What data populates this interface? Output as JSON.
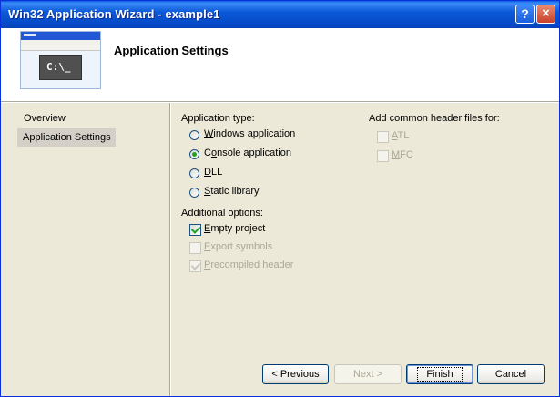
{
  "window": {
    "title": "Win32 Application Wizard - example1"
  },
  "titlebar_buttons": {
    "help": "?",
    "close": "×"
  },
  "header": {
    "title": "Application Settings",
    "console_text": "C:\\_"
  },
  "nav": {
    "items": [
      "Overview",
      "Application Settings"
    ],
    "selected_index": 1
  },
  "app_type": {
    "label": "Application type:",
    "options": [
      {
        "pre": "",
        "key": "W",
        "post": "indows application",
        "checked": false
      },
      {
        "pre": "C",
        "key": "o",
        "post": "nsole application",
        "checked": true
      },
      {
        "pre": "",
        "key": "D",
        "post": "LL",
        "checked": false
      },
      {
        "pre": "",
        "key": "S",
        "post": "tatic library",
        "checked": false
      }
    ]
  },
  "additional": {
    "label": "Additional options:",
    "options": [
      {
        "pre": "",
        "key": "E",
        "post": "mpty project",
        "checked": true,
        "enabled": true
      },
      {
        "pre": "",
        "key": "E",
        "post": "xport symbols",
        "checked": false,
        "enabled": false
      },
      {
        "pre": "",
        "key": "P",
        "post": "recompiled header",
        "checked": true,
        "enabled": false
      }
    ]
  },
  "headers": {
    "label": "Add common header files for:",
    "options": [
      {
        "pre": "",
        "key": "A",
        "post": "TL",
        "checked": false,
        "enabled": false
      },
      {
        "pre": "",
        "key": "M",
        "post": "FC",
        "checked": false,
        "enabled": false
      }
    ]
  },
  "buttons": {
    "previous": "< Previous",
    "next": "Next >",
    "finish": "Finish",
    "cancel": "Cancel"
  }
}
